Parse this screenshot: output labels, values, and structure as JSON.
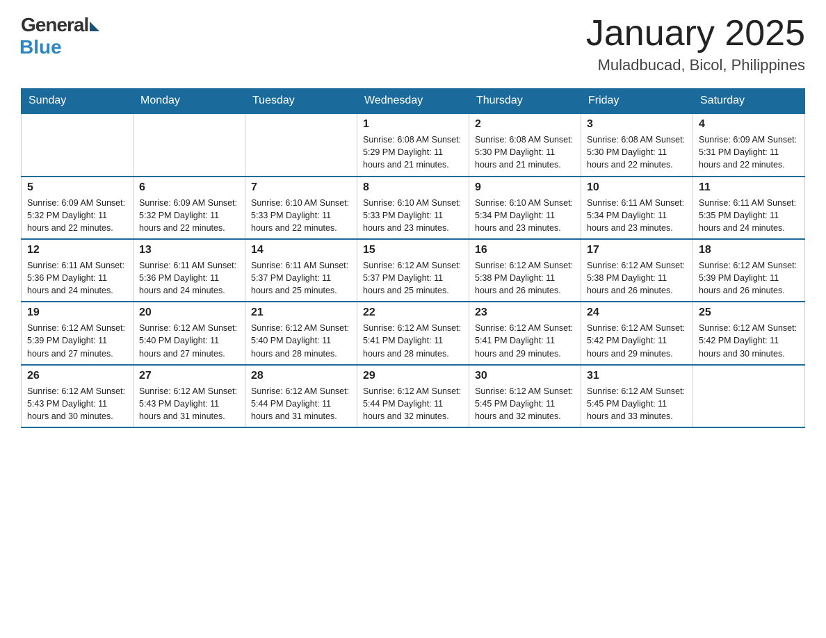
{
  "header": {
    "logo_general": "General",
    "logo_blue": "Blue",
    "month_title": "January 2025",
    "location": "Muladbucad, Bicol, Philippines"
  },
  "days_of_week": [
    "Sunday",
    "Monday",
    "Tuesday",
    "Wednesday",
    "Thursday",
    "Friday",
    "Saturday"
  ],
  "weeks": [
    [
      {
        "day": "",
        "info": ""
      },
      {
        "day": "",
        "info": ""
      },
      {
        "day": "",
        "info": ""
      },
      {
        "day": "1",
        "info": "Sunrise: 6:08 AM\nSunset: 5:29 PM\nDaylight: 11 hours\nand 21 minutes."
      },
      {
        "day": "2",
        "info": "Sunrise: 6:08 AM\nSunset: 5:30 PM\nDaylight: 11 hours\nand 21 minutes."
      },
      {
        "day": "3",
        "info": "Sunrise: 6:08 AM\nSunset: 5:30 PM\nDaylight: 11 hours\nand 22 minutes."
      },
      {
        "day": "4",
        "info": "Sunrise: 6:09 AM\nSunset: 5:31 PM\nDaylight: 11 hours\nand 22 minutes."
      }
    ],
    [
      {
        "day": "5",
        "info": "Sunrise: 6:09 AM\nSunset: 5:32 PM\nDaylight: 11 hours\nand 22 minutes."
      },
      {
        "day": "6",
        "info": "Sunrise: 6:09 AM\nSunset: 5:32 PM\nDaylight: 11 hours\nand 22 minutes."
      },
      {
        "day": "7",
        "info": "Sunrise: 6:10 AM\nSunset: 5:33 PM\nDaylight: 11 hours\nand 22 minutes."
      },
      {
        "day": "8",
        "info": "Sunrise: 6:10 AM\nSunset: 5:33 PM\nDaylight: 11 hours\nand 23 minutes."
      },
      {
        "day": "9",
        "info": "Sunrise: 6:10 AM\nSunset: 5:34 PM\nDaylight: 11 hours\nand 23 minutes."
      },
      {
        "day": "10",
        "info": "Sunrise: 6:11 AM\nSunset: 5:34 PM\nDaylight: 11 hours\nand 23 minutes."
      },
      {
        "day": "11",
        "info": "Sunrise: 6:11 AM\nSunset: 5:35 PM\nDaylight: 11 hours\nand 24 minutes."
      }
    ],
    [
      {
        "day": "12",
        "info": "Sunrise: 6:11 AM\nSunset: 5:36 PM\nDaylight: 11 hours\nand 24 minutes."
      },
      {
        "day": "13",
        "info": "Sunrise: 6:11 AM\nSunset: 5:36 PM\nDaylight: 11 hours\nand 24 minutes."
      },
      {
        "day": "14",
        "info": "Sunrise: 6:11 AM\nSunset: 5:37 PM\nDaylight: 11 hours\nand 25 minutes."
      },
      {
        "day": "15",
        "info": "Sunrise: 6:12 AM\nSunset: 5:37 PM\nDaylight: 11 hours\nand 25 minutes."
      },
      {
        "day": "16",
        "info": "Sunrise: 6:12 AM\nSunset: 5:38 PM\nDaylight: 11 hours\nand 26 minutes."
      },
      {
        "day": "17",
        "info": "Sunrise: 6:12 AM\nSunset: 5:38 PM\nDaylight: 11 hours\nand 26 minutes."
      },
      {
        "day": "18",
        "info": "Sunrise: 6:12 AM\nSunset: 5:39 PM\nDaylight: 11 hours\nand 26 minutes."
      }
    ],
    [
      {
        "day": "19",
        "info": "Sunrise: 6:12 AM\nSunset: 5:39 PM\nDaylight: 11 hours\nand 27 minutes."
      },
      {
        "day": "20",
        "info": "Sunrise: 6:12 AM\nSunset: 5:40 PM\nDaylight: 11 hours\nand 27 minutes."
      },
      {
        "day": "21",
        "info": "Sunrise: 6:12 AM\nSunset: 5:40 PM\nDaylight: 11 hours\nand 28 minutes."
      },
      {
        "day": "22",
        "info": "Sunrise: 6:12 AM\nSunset: 5:41 PM\nDaylight: 11 hours\nand 28 minutes."
      },
      {
        "day": "23",
        "info": "Sunrise: 6:12 AM\nSunset: 5:41 PM\nDaylight: 11 hours\nand 29 minutes."
      },
      {
        "day": "24",
        "info": "Sunrise: 6:12 AM\nSunset: 5:42 PM\nDaylight: 11 hours\nand 29 minutes."
      },
      {
        "day": "25",
        "info": "Sunrise: 6:12 AM\nSunset: 5:42 PM\nDaylight: 11 hours\nand 30 minutes."
      }
    ],
    [
      {
        "day": "26",
        "info": "Sunrise: 6:12 AM\nSunset: 5:43 PM\nDaylight: 11 hours\nand 30 minutes."
      },
      {
        "day": "27",
        "info": "Sunrise: 6:12 AM\nSunset: 5:43 PM\nDaylight: 11 hours\nand 31 minutes."
      },
      {
        "day": "28",
        "info": "Sunrise: 6:12 AM\nSunset: 5:44 PM\nDaylight: 11 hours\nand 31 minutes."
      },
      {
        "day": "29",
        "info": "Sunrise: 6:12 AM\nSunset: 5:44 PM\nDaylight: 11 hours\nand 32 minutes."
      },
      {
        "day": "30",
        "info": "Sunrise: 6:12 AM\nSunset: 5:45 PM\nDaylight: 11 hours\nand 32 minutes."
      },
      {
        "day": "31",
        "info": "Sunrise: 6:12 AM\nSunset: 5:45 PM\nDaylight: 11 hours\nand 33 minutes."
      },
      {
        "day": "",
        "info": ""
      }
    ]
  ]
}
